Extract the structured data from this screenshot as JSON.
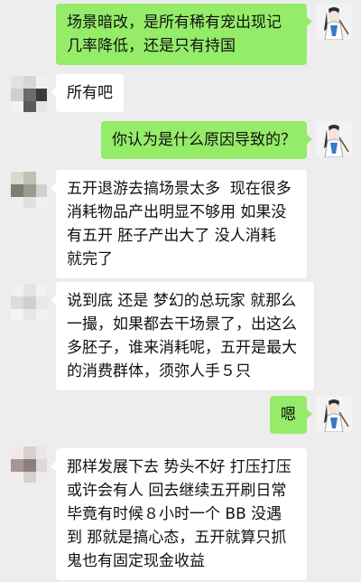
{
  "colors": {
    "background": "#ededed",
    "outgoing_bubble": "#95ec69",
    "incoming_bubble": "#ffffff"
  },
  "self_avatar": {
    "icon": "cartoon-swordsman-avatar-icon"
  },
  "other_avatar": {
    "icon": "pixelated-avatar-icon"
  },
  "messages": [
    {
      "from": "self",
      "text": "场景暗改，是所有稀有宠出现记几率降低，还是只有持国"
    },
    {
      "from": "other",
      "text": "所有吧"
    },
    {
      "from": "self",
      "text": "你认为是什么原因导致的？"
    },
    {
      "from": "other",
      "text": "五开退游去搞场景太多  现在很多消耗物品产出明显不够用 如果没有五开 胚子产出大了 没人消耗 就完了"
    },
    {
      "from": "other",
      "text": "说到底 还是 梦幻的总玩家 就那么一撮，如果都去干场景了，出这么多胚子，谁来消耗呢，五开是最大的消费群体，须弥人手５只"
    },
    {
      "from": "self",
      "text": "嗯"
    },
    {
      "from": "other",
      "text": "那样发展下去 势头不好 打压打压或许会有人 回去继续五开刷日常 毕竟有时候８小时一个 BB 没遇到 那就是搞心态，五开就算只抓鬼也有固定现金收益"
    }
  ]
}
